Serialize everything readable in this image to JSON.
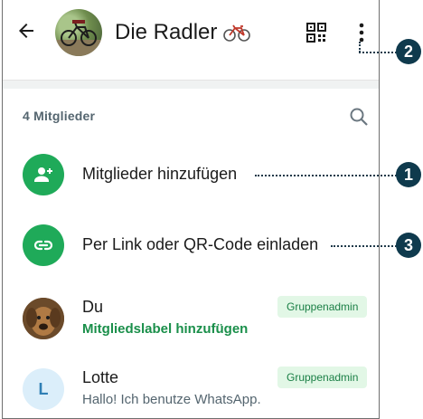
{
  "header": {
    "title": "Die Radler",
    "title_emoji": "bicycle-emoji",
    "back_icon": "arrow-left-icon",
    "qr_icon": "qr-code-icon",
    "menu_icon": "more-vert-icon"
  },
  "members_section": {
    "count_label": "4 Mitglieder",
    "search_icon": "search-icon"
  },
  "actions": [
    {
      "label": "Mitglieder hinzufügen",
      "icon": "add-person-icon"
    },
    {
      "label": "Per Link oder QR-Code einladen",
      "icon": "link-icon"
    }
  ],
  "members": [
    {
      "name": "Du",
      "subtitle": "Mitgliedslabel hinzufügen",
      "badge": "Gruppenadmin",
      "avatar": "dog-photo"
    },
    {
      "name": "Lotte",
      "subtitle": "Hallo! Ich benutze WhatsApp.",
      "badge": "Gruppenadmin",
      "avatar_letter": "L"
    }
  ],
  "callouts": [
    "1",
    "2",
    "3"
  ],
  "colors": {
    "accent_green": "#1faa59",
    "badge_bg": "#e2f7e6",
    "callout_bg": "#0f3a4d"
  }
}
